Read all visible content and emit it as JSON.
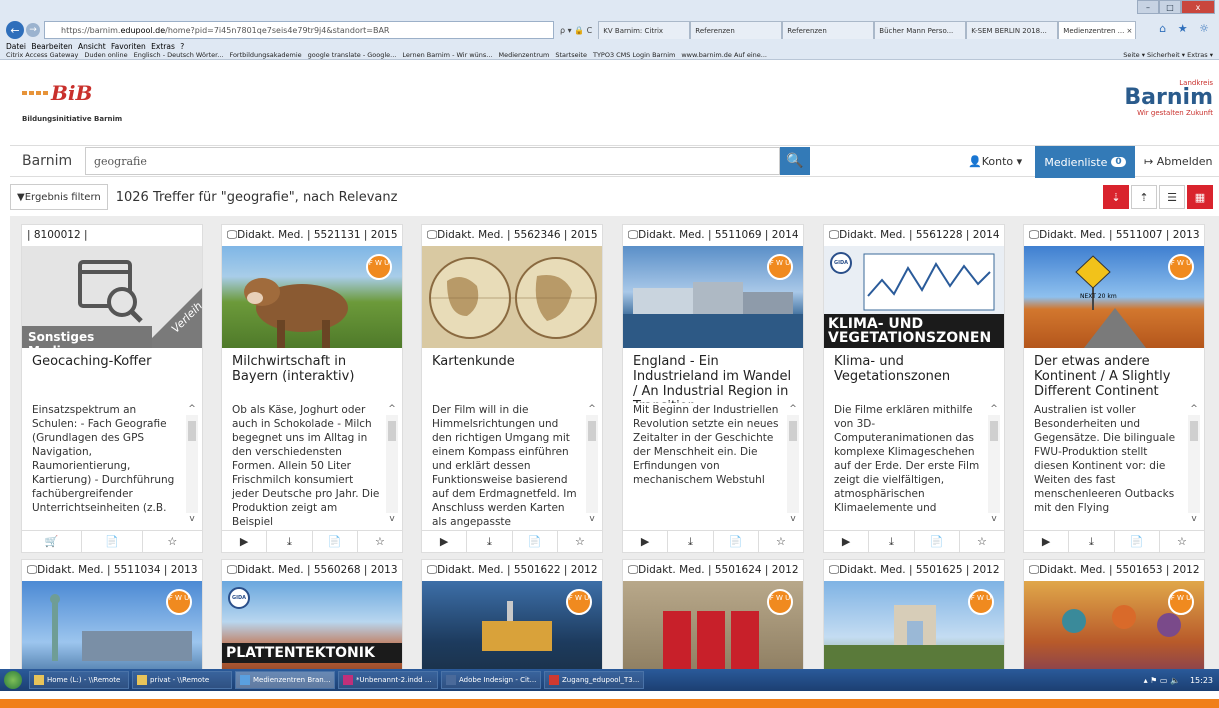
{
  "browser": {
    "url_prefix": "https://barnim.",
    "url_domain": "edupool.de",
    "url_rest": "/home?pid=7i45n7801qe7seis4e79tr9j4&standort=BAR",
    "url_icons": "ρ ▾ 🔒 C",
    "tabs": [
      "KV Barnim: Citrix",
      "Referenzen",
      "Referenzen",
      "Bücher Mann Perso...",
      "K-SEM BERLIN 2018...",
      "Medienzentren ..."
    ],
    "tab_close": "×",
    "home_icons": "⌂ ★ ☼",
    "menu": "Datei Bearbeiten Ansicht Favoriten Extras ?",
    "favorites": [
      "Citrix Access Gateway",
      "Duden online",
      "Englisch - Deutsch Wörter...",
      "Fortbildungsakademie",
      "google translate - Google...",
      "Lernen Barnim - Wir wüns...",
      "Medienzentrum",
      "Startseite",
      "TYPO3 CMS Login Barnim",
      "www.barnim.de Auf eine..."
    ],
    "fav_right": "Seite ▾  Sicherheit ▾  Extras ▾",
    "win_min": "–",
    "win_max": "□",
    "win_close": "x"
  },
  "header": {
    "bib_text": "BiB",
    "bib_subtitle": "Bildungsinitiative Barnim",
    "landkreis": "Landkreis",
    "barnim_logo": "Barnim",
    "claim": "Wir gestalten Zukunft"
  },
  "search": {
    "label": "Barnim",
    "value": "geografie",
    "button_icon": "🔍",
    "konto": "👤Konto ▾",
    "medienliste": "Medienliste",
    "medienliste_count": "0",
    "abmelden": "↦ Abmelden"
  },
  "results": {
    "filter": "▼Ergebnis filtern",
    "summary": "1026 Treffer für \"geografie\", nach Relevanz",
    "view_icons": [
      "⇣",
      "⇡",
      "☰",
      "▦"
    ]
  },
  "cards_row1": [
    {
      "head": "| 8100012 |",
      "title": "Geocaching-Koffer",
      "img_label": "Sonstiges Medium",
      "ribbon": "Verleih",
      "desc": "Einsatzspektrum an Schulen: - Fach Geografie (Grundlagen des GPS Navigation, Raumorientierung, Kartierung) - Durchführung fachübergreifender Unterrichtseinheiten (z.B.",
      "actions": [
        "🛒",
        "📄",
        "☆"
      ]
    },
    {
      "head": "🖵Didakt. Med. | 5521131 | 2015",
      "title": "Milchwirtschaft in Bayern (interaktiv)",
      "desc": "Ob als Käse, Joghurt oder auch in Schokolade - Milch begegnet uns im Alltag in den verschiedensten Formen. Allein 50 Liter Frischmilch konsumiert jeder Deutsche pro Jahr. Die Produktion zeigt am Beispiel",
      "actions": [
        "▶",
        "⤓",
        "📄",
        "☆"
      ]
    },
    {
      "head": "🖵Didakt. Med. | 5562346 | 2015",
      "title": "Kartenkunde",
      "desc": "Der Film will in die Himmelsrichtungen und den richtigen Umgang mit einem Kompass einführen und erklärt dessen Funktionsweise basierend auf dem Erdmagnetfeld. Im Anschluss werden Karten als angepasste Vogelperspektive",
      "actions": [
        "▶",
        "⤓",
        "📄",
        "☆"
      ]
    },
    {
      "head": "🖵Didakt. Med. | 5511069 | 2014",
      "title": "England - Ein Industrieland im Wandel / An Industrial Region in Transition",
      "desc": "Mit Beginn der Industriellen Revolution setzte ein neues Zeitalter in der Geschichte der Menschheit ein. Die Erfindungen von mechanischem Webstuhl",
      "actions": [
        "▶",
        "⤓",
        "📄",
        "☆"
      ]
    },
    {
      "head": "🖵Didakt. Med. | 5561228 | 2014",
      "title": "Klima- und Vegetationszonen",
      "img_label": "KLIMA- UND VEGETATIONSZONEN",
      "desc": "Die Filme erklären mithilfe von 3D-Computeranimationen das komplexe Klimageschehen auf der Erde. Der erste Film zeigt die vielfältigen, atmosphärischen Klimaelemente und",
      "actions": [
        "▶",
        "⤓",
        "📄",
        "☆"
      ]
    },
    {
      "head": "🖵Didakt. Med. | 5511007 | 2013",
      "title": "Der etwas andere Kontinent / A Slightly Different Continent",
      "desc": "Australien ist voller Besonderheiten und Gegensätze. Die bilinguale FWU-Produktion stellt diesen Kontinent vor: die Weiten des fast menschenleeren Outbacks mit den Flying",
      "actions": [
        "▶",
        "⤓",
        "📄",
        "☆"
      ]
    }
  ],
  "cards_row2": [
    {
      "head": "🖵Didakt. Med. | 5511034 | 2013"
    },
    {
      "head": "🖵Didakt. Med. | 5560268 | 2013",
      "img_label": "PLATTENTEKTONIK"
    },
    {
      "head": "🖵Didakt. Med. | 5501622 | 2012"
    },
    {
      "head": "🖵Didakt. Med. | 5501624 | 2012"
    },
    {
      "head": "🖵Didakt. Med. | 5501625 | 2012"
    },
    {
      "head": "🖵Didakt. Med. | 5501653 | 2012"
    }
  ],
  "badges": {
    "fwu": "F W U",
    "gida": "GIDA",
    "sign": "NEXT 20 km"
  },
  "scroll": {
    "up": "^",
    "down": "v"
  },
  "taskbar": {
    "items": [
      "Home (L:) - \\\\Remote",
      "privat - \\\\Remote",
      "Medienzentren Bran...",
      "*Unbenannt-2.indd ...",
      "Adobe Indesign - Cit...",
      "Zugang_edupool_T3..."
    ],
    "tray_icons": "▴ ⚑ ▭ 🔈",
    "clock": "15:23"
  },
  "colors": {
    "accent": "#337ab7",
    "red": "#d9232d",
    "fwu": "#f08a1f",
    "bottom": "#f07f1a"
  }
}
